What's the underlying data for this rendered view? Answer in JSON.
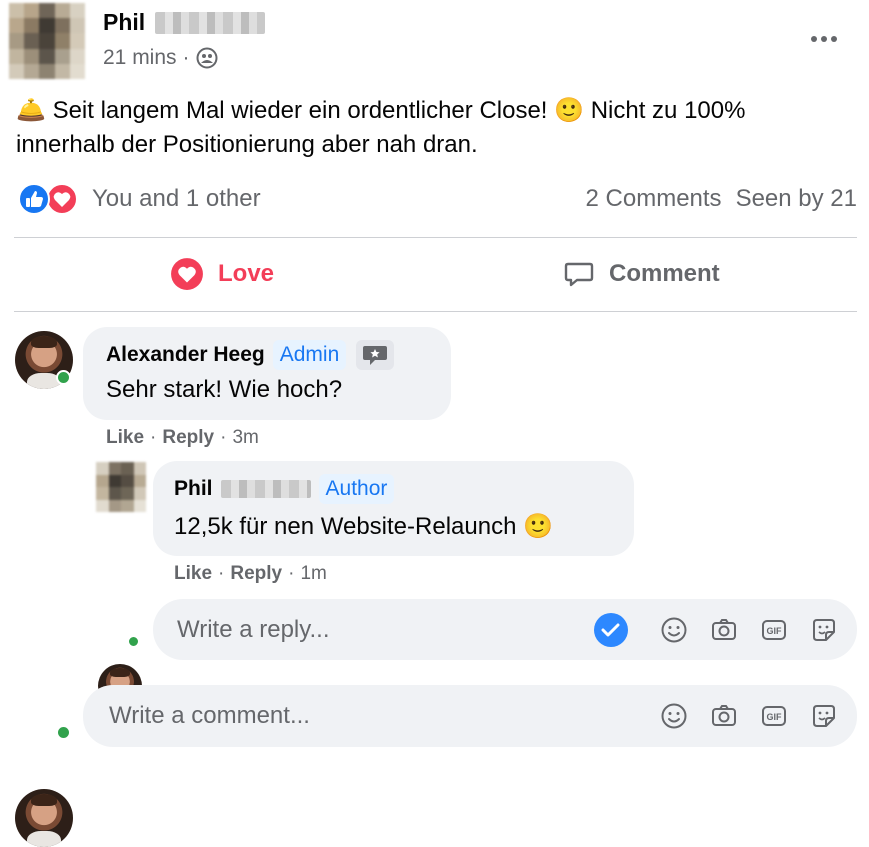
{
  "post": {
    "author_first": "Phil",
    "time": "21 mins",
    "time_sep": "·",
    "audience_icon": "group-icon",
    "more_icon": "more-options-icon",
    "text_emoji_1": "🛎️",
    "text_part_1": "Seit langem Mal wieder ein ordentlicher Close! ",
    "text_emoji_2": "🙂",
    "text_part_2": " Nicht zu 100% innerhalb der Positionierung aber nah dran.",
    "reactions_text": "You and 1 other",
    "comments_count": "2 Comments",
    "seen_by": "Seen by 21"
  },
  "actions": {
    "love_label": "Love",
    "comment_label": "Comment"
  },
  "comments": [
    {
      "author": "Alexander Heeg",
      "badge": "Admin",
      "text": "Sehr stark! Wie hoch?",
      "like": "Like",
      "reply": "Reply",
      "time": "3m"
    }
  ],
  "reply": {
    "author_first": "Phil",
    "badge": "Author",
    "text": "12,5k für nen Website-Relaunch ",
    "emoji": "🙂",
    "like": "Like",
    "reply": "Reply",
    "time": "1m"
  },
  "reply_composer": {
    "placeholder": "Write a reply..."
  },
  "comment_composer": {
    "placeholder": "Write a comment..."
  },
  "sep": "·",
  "colors": {
    "love": "#f33e58",
    "like_blue": "#1877f2",
    "online": "#31a24c"
  }
}
